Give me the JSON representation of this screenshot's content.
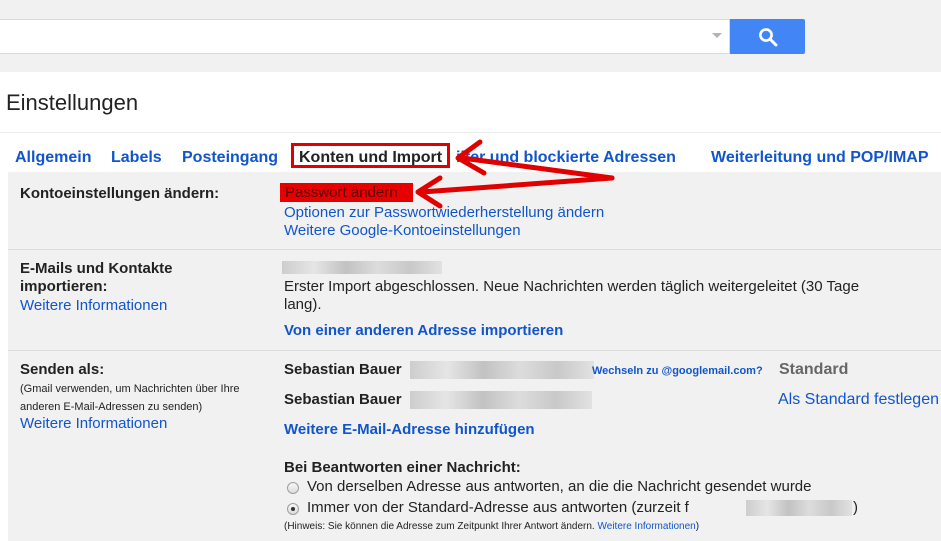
{
  "search": {
    "placeholder": ""
  },
  "page_title": "Einstellungen",
  "tabs": [
    {
      "label": "Allgemein"
    },
    {
      "label": "Labels"
    },
    {
      "label": "Posteingang"
    },
    {
      "label": "Konten und Import"
    },
    {
      "label": "ilter und blockierte Adressen"
    },
    {
      "label": "Weiterleitung und POP/IMAP"
    }
  ],
  "account": {
    "label": "Kontoeinstellungen ändern:",
    "change_password": "Passwort ändern",
    "recovery_options": "Optionen zur Passwortwiederherstellung ändern",
    "google_settings": "Weitere Google-Kontoeinstellungen"
  },
  "import": {
    "label_line1": "E-Mails und Kontakte",
    "label_line2": "importieren:",
    "more_info": "Weitere Informationen",
    "status_line1": "Erster Import abgeschlossen. Neue Nachrichten werden täglich weitergeleitet (30 Tage",
    "status_line2": "lang).",
    "import_link": "Von einer anderen Adresse importieren"
  },
  "send_as": {
    "label": "Senden als:",
    "hint_line1": "(Gmail verwenden, um Nachrichten über Ihre",
    "hint_line2": "anderen E-Mail-Adressen zu senden)",
    "more_info": "Weitere Informationen",
    "entries": [
      {
        "name": "Sebastian Bauer",
        "switch_link": "Wechseln zu @googlemail.com?",
        "status": "Standard"
      },
      {
        "name": "Sebastian Bauer",
        "action": "Als Standard festlegen"
      }
    ],
    "add_address": "Weitere E-Mail-Adresse hinzufügen",
    "reply_heading": "Bei Beantworten einer Nachricht:",
    "reply_option1": "Von derselben Adresse aus antworten, an die die Nachricht gesendet wurde",
    "reply_option2": "Immer von der Standard-Adresse aus antworten (zurzeit f",
    "reply_option2_end": ")",
    "reply_hint": "(Hinweis: Sie können die Adresse zum Zeitpunkt Ihrer Antwort ändern.",
    "reply_hint_link": "Weitere Informationen",
    "reply_hint_end": ")",
    "reply_selected": 2
  },
  "colors": {
    "link": "#1155cc",
    "search_button": "#4285f4",
    "annotation_red": "#e00000"
  }
}
